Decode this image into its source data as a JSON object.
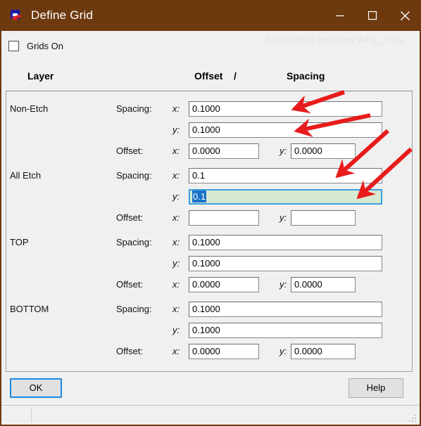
{
  "window": {
    "title": "Define Grid",
    "icon": "app-icon",
    "titlebar_color": "#6d3a10",
    "caption": {
      "minimize": "minimize-icon",
      "maximize": "maximize-icon",
      "close": "close-icon"
    }
  },
  "grids_on": {
    "label": "Grids On",
    "checked": false
  },
  "header": {
    "layer": "Layer",
    "offset": "Offset",
    "slash": "/",
    "spacing": "Spacing"
  },
  "labels": {
    "spacing": "Spacing:",
    "offset": "Offset:",
    "x": "x:",
    "y": "y:"
  },
  "layers": [
    {
      "name": "Non-Etch",
      "spacing_x": "0.1000",
      "spacing_y": "0.1000",
      "offset_x": "0.0000",
      "offset_y": "0.0000",
      "focused": false
    },
    {
      "name": "All Etch",
      "spacing_x": "0.1",
      "spacing_y": "0.1",
      "offset_x": "",
      "offset_y": "",
      "focused": true,
      "focus_field": "spacing_y",
      "selection_color": "#1a72c8",
      "focus_background": "#d7ead1"
    },
    {
      "name": "TOP",
      "spacing_x": "0.1000",
      "spacing_y": "0.1000",
      "offset_x": "0.0000",
      "offset_y": "0.0000",
      "focused": false
    },
    {
      "name": "BOTTOM",
      "spacing_x": "0.1000",
      "spacing_y": "0.1000",
      "offset_x": "0.0000",
      "offset_y": "0.0000",
      "focused": false
    }
  ],
  "buttons": {
    "ok": "OK",
    "help": "Help"
  },
  "annotations": {
    "arrow_color": "#e81c1c",
    "count": 4
  },
  "watermark": "https://blog.csdn.net/WHL_YSU"
}
